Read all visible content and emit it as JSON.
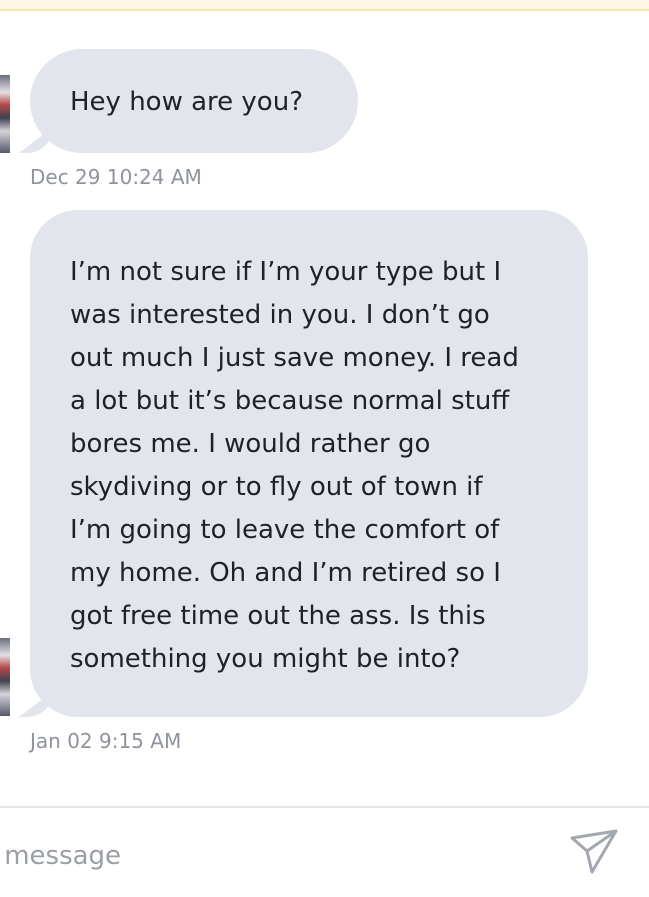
{
  "messages": [
    {
      "lines": [
        "Hey how are you?"
      ],
      "timestamp": "Dec 29 10:24 AM"
    },
    {
      "lines": [
        "I’m not sure if I’m your type but I",
        "was interested in you. I don’t go",
        "out much I just save money. I read",
        "a lot but it’s because normal stuff",
        "bores me. I would rather go",
        "skydiving or to fly out of town if",
        "I’m going to leave the comfort of",
        "my home. Oh and I’m retired so I",
        "got free time out the ass. Is this",
        "something you might be into?"
      ],
      "timestamp": "Jan 02 9:15 AM"
    }
  ],
  "composer": {
    "placeholder": "a message",
    "send_icon": "send-icon"
  },
  "colors": {
    "bubble": "#e3e5ec",
    "timestamp": "#8f939c",
    "banner": "#fdf8e6"
  }
}
